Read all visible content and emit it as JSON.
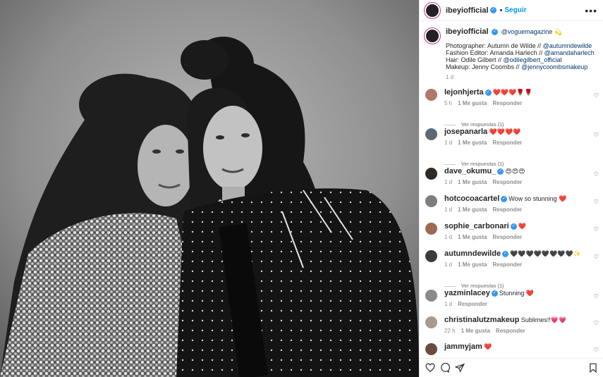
{
  "post": {
    "photo_alt": "Black and white portrait of two women",
    "author": "ibeyiofficial",
    "follow_label": "Seguir",
    "more_label": "•••"
  },
  "caption": {
    "author": "ibeyiofficial",
    "mention": "@voguemagazine",
    "emoji": "💫",
    "lines": [
      {
        "prefix": "Photographer: Autumn de Wilde // ",
        "handle": "@autumndewilde"
      },
      {
        "prefix": "Fashion Editor: Amanda Harlech // ",
        "handle": "@amandaharlech"
      },
      {
        "prefix": "Hair: Odile Gilbert // ",
        "handle": "@odilegilbert_official"
      },
      {
        "prefix": "Makeup: Jenny Coombs // ",
        "handle": "@jennycoombsmakeup"
      }
    ],
    "time": "1 d"
  },
  "comments": [
    {
      "user": "lejonhjerta",
      "verified": true,
      "text": "❤️❤️❤️🌹🌹",
      "time": "5 h",
      "likes": "1 Me gusta",
      "reply": "Responder",
      "replies": "Ver respuestas (1)",
      "avatar": "#b0776b"
    },
    {
      "user": "josepanarla",
      "verified": false,
      "text": "❤️❤️❤️❤️",
      "time": "1 d",
      "likes": "1 Me gusta",
      "reply": "Responder",
      "replies": "Ver respuestas (1)",
      "avatar": "#5e6a73"
    },
    {
      "user": "dave_okumu_",
      "verified": true,
      "text": "😍😍😍",
      "time": "1 d",
      "likes": "1 Me gusta",
      "reply": "Responder",
      "replies": "",
      "avatar": "#2f2a24"
    },
    {
      "user": "hotcocoacartel",
      "verified": true,
      "text": "Wow so stunning ❤️",
      "time": "1 d",
      "likes": "1 Me gusta",
      "reply": "Responder",
      "replies": "",
      "avatar": "#7d7d7d"
    },
    {
      "user": "sophie_carbonari",
      "verified": true,
      "text": "❤️",
      "time": "1 d",
      "likes": "1 Me gusta",
      "reply": "Responder",
      "replies": "",
      "avatar": "#9c6a52"
    },
    {
      "user": "autumndewilde",
      "verified": true,
      "text": "🖤🖤🖤🖤🖤🖤🖤🖤✨",
      "time": "1 d",
      "likes": "1 Me gusta",
      "reply": "Responder",
      "replies": "Ver respuestas (1)",
      "avatar": "#3b3b3b"
    },
    {
      "user": "yazminlacey",
      "verified": true,
      "text": "Stunning ❤️",
      "time": "1 d",
      "likes": "",
      "reply": "Responder",
      "replies": "",
      "avatar": "#8a8a8a"
    },
    {
      "user": "christinalutzmakeup",
      "verified": false,
      "text": "Sublimes!!💗💗",
      "time": "22 h",
      "likes": "1 Me gusta",
      "reply": "Responder",
      "replies": "",
      "avatar": "#a89a8c"
    },
    {
      "user": "jammyjam",
      "verified": false,
      "text": "❤️",
      "time": "",
      "likes": "",
      "reply": "",
      "replies": "",
      "avatar": "#6e4a3e"
    }
  ],
  "actions": [
    "heart-icon",
    "comment-icon",
    "share-icon",
    "bookmark-icon"
  ]
}
